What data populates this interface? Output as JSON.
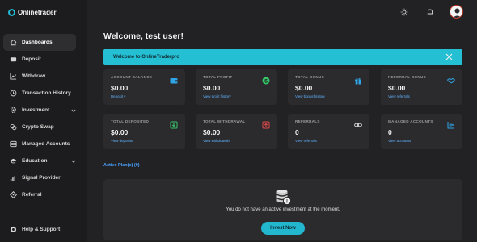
{
  "brand": {
    "name": "Onlinetrader"
  },
  "sidebar": {
    "items": [
      {
        "label": "Dashboards",
        "icon": "home-icon"
      },
      {
        "label": "Deposit",
        "icon": "wallet-icon"
      },
      {
        "label": "Withdraw",
        "icon": "chart-line-icon"
      },
      {
        "label": "Transaction History",
        "icon": "history-icon"
      },
      {
        "label": "Investment",
        "icon": "gear-icon"
      },
      {
        "label": "Crypto Swap",
        "icon": "swap-icon"
      },
      {
        "label": "Managed Accounts",
        "icon": "accounts-icon"
      },
      {
        "label": "Education",
        "icon": "graduation-cap-icon"
      },
      {
        "label": "Signal Provider",
        "icon": "signal-bars-icon"
      },
      {
        "label": "Referral",
        "icon": "referral-icon"
      }
    ],
    "help": "Help & Support"
  },
  "header": {
    "welcome": "Welcome, test user!",
    "alert": "Welcome to OnlineTraderpro"
  },
  "cards": [
    {
      "label": "ACCOUNT BALANCE",
      "value": "$0.00",
      "link": "Deposit ▾",
      "icon": "wallet-icon",
      "color": "#2fa4e7"
    },
    {
      "label": "TOTAL PROFIT",
      "value": "$0.00",
      "link": "View profit history",
      "icon": "dollar-coin-icon",
      "color": "#37c76b"
    },
    {
      "label": "TOTAL BONUS",
      "value": "$0.00",
      "link": "View bonus history",
      "icon": "gift-icon",
      "color": "#2fa4e7"
    },
    {
      "label": "REFERRAL BONUS",
      "value": "$0.00",
      "link": "View referrals",
      "icon": "handshake-icon",
      "color": "#2fa4e7"
    },
    {
      "label": "TOTAL DEPOSITED",
      "value": "$0.00",
      "link": "View deposits",
      "icon": "download-icon",
      "color": "#37c76b"
    },
    {
      "label": "TOTAL WITHDRAWAL",
      "value": "$0.00",
      "link": "View withdrawals",
      "icon": "upload-icon",
      "color": "#e24a4a"
    },
    {
      "label": "REFERRALS",
      "value": "0",
      "link": "View referrals",
      "icon": "link-icon",
      "color": "#cfcfcf"
    },
    {
      "label": "MANAGED ACCOUNTS",
      "value": "0",
      "link": "View accounts",
      "icon": "bars-icon",
      "color": "#2fa4e7"
    }
  ],
  "plans": {
    "title": "Active Plan(s) (0)",
    "empty_message": "You do not have an active investment at the moment.",
    "button": "Invest Now"
  }
}
